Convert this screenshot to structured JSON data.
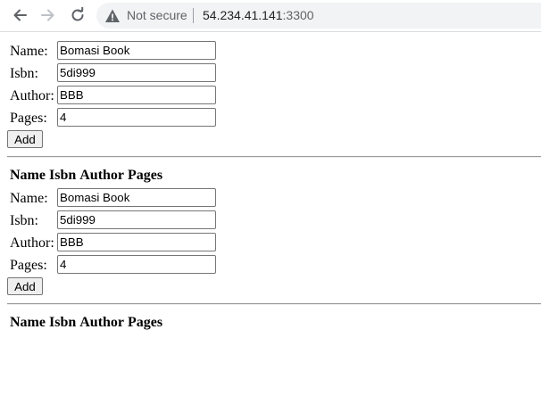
{
  "browser": {
    "not_secure_label": "Not secure",
    "url_host": "54.234.41.141",
    "url_port": ":3300"
  },
  "forms": [
    {
      "fields": [
        {
          "label": "Name:",
          "value": "Bomasi Book"
        },
        {
          "label": "Isbn:",
          "value": "5di999"
        },
        {
          "label": "Author:",
          "value": "BBB"
        },
        {
          "label": "Pages:",
          "value": "4"
        }
      ],
      "add_label": "Add",
      "table_headers": [
        "Name",
        "Isbn",
        "Author",
        "Pages"
      ]
    },
    {
      "fields": [
        {
          "label": "Name:",
          "value": "Bomasi Book"
        },
        {
          "label": "Isbn:",
          "value": "5di999"
        },
        {
          "label": "Author:",
          "value": "BBB"
        },
        {
          "label": "Pages:",
          "value": "4"
        }
      ],
      "add_label": "Add",
      "table_headers": [
        "Name",
        "Isbn",
        "Author",
        "Pages"
      ]
    }
  ]
}
